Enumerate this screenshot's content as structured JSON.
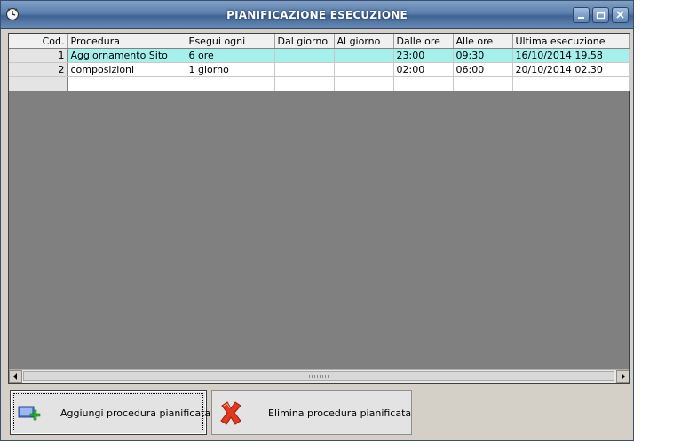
{
  "window": {
    "title": "PIANIFICAZIONE ESECUZIONE"
  },
  "grid": {
    "columns": [
      "Cod.",
      "Procedura",
      "Esegui ogni",
      "Dal giorno",
      "Al giorno",
      "Dalle ore",
      "Alle ore",
      "Ultima esecuzione"
    ],
    "rows": [
      {
        "cod": "1",
        "procedura": "Aggiornamento Sito",
        "esegui_ogni": "6 ore",
        "dal_giorno": "",
        "al_giorno": "",
        "dalle_ore": "23:00",
        "alle_ore": "09:30",
        "ultima_esecuzione": "16/10/2014 19.58",
        "selected": true
      },
      {
        "cod": "2",
        "procedura": "composizioni",
        "esegui_ogni": "1 giorno",
        "dal_giorno": "",
        "al_giorno": "",
        "dalle_ore": "02:00",
        "alle_ore": "06:00",
        "ultima_esecuzione": "20/10/2014 02.30",
        "selected": false
      }
    ],
    "selected_row_color": "#a6f0ec"
  },
  "buttons": {
    "add_label": "Aggiungi procedura pianificata",
    "add_icon": "add-schedule-icon",
    "delete_label": "Elimina procedura pianificata",
    "delete_icon": "red-x-icon"
  },
  "colors": {
    "titlebar": "#4f73a3",
    "grid_background": "#808080",
    "window_background": "#d4d0c8"
  }
}
